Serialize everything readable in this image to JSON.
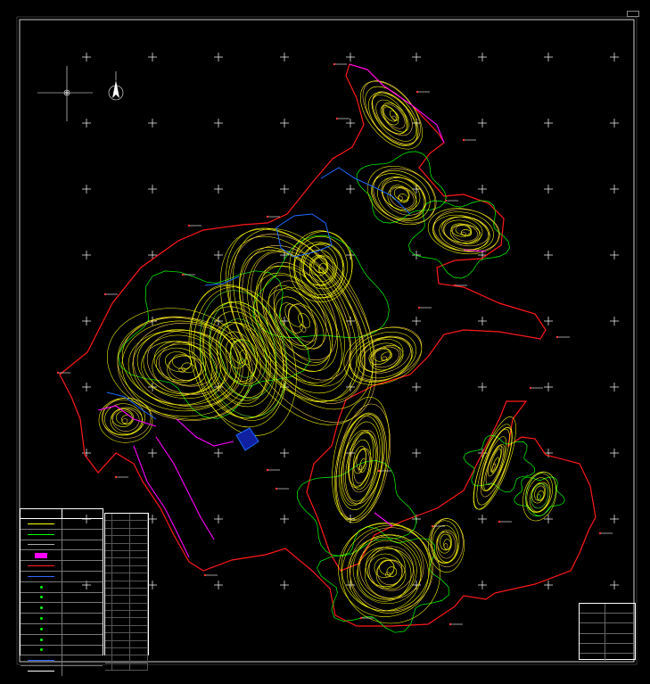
{
  "title": "",
  "colors": {
    "background": "#000000",
    "boundary": "#ff0000",
    "contour_major": "#ffff00",
    "contour_minor": "#ffcc66",
    "vegetation": "#00ff00",
    "water": "#0066ff",
    "building": "#ff00ff",
    "label": "#ffffff",
    "annotation": "#ff3333"
  },
  "icons": {
    "north_arrow": "north-arrow-icon",
    "crosshair": "crosshair-icon",
    "grid_mark": "grid-plus-icon"
  },
  "legend": {
    "headers": [
      "",
      ""
    ],
    "rows": [
      {
        "symbol": "yellow-contour",
        "label": ""
      },
      {
        "symbol": "green-hatch",
        "label": ""
      },
      {
        "symbol": "grey-line",
        "label": ""
      },
      {
        "symbol": "magenta-block",
        "label": ""
      },
      {
        "symbol": "red-line",
        "label": ""
      },
      {
        "symbol": "blue-line",
        "label": ""
      },
      {
        "symbol": "green-dot",
        "label": ""
      },
      {
        "symbol": "green-dot",
        "label": ""
      },
      {
        "symbol": "green-dot",
        "label": ""
      },
      {
        "symbol": "green-dot",
        "label": ""
      },
      {
        "symbol": "green-dot",
        "label": ""
      },
      {
        "symbol": "green-dot",
        "label": ""
      },
      {
        "symbol": "green-dot",
        "label": ""
      },
      {
        "symbol": "blue-line",
        "label": ""
      },
      {
        "symbol": "white-line",
        "label": ""
      }
    ]
  },
  "info_table": [
    {
      "key": "",
      "value": ""
    },
    {
      "key": "",
      "value": ""
    },
    {
      "key": "",
      "value": ""
    },
    {
      "key": "",
      "value": ""
    },
    {
      "key": "",
      "value": ""
    },
    {
      "key": "",
      "value": ""
    }
  ]
}
